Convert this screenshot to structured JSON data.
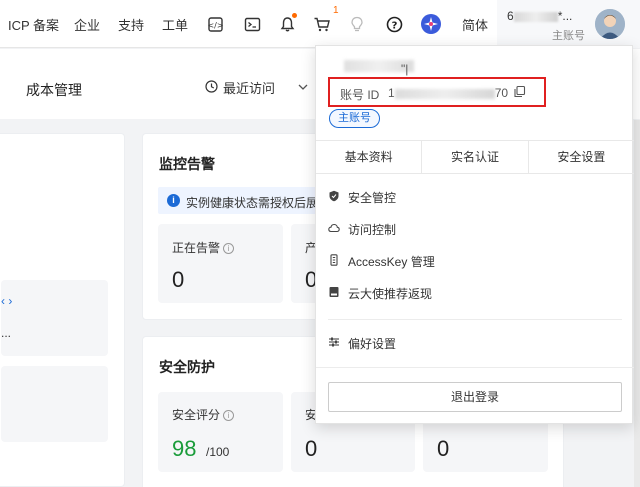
{
  "topbar": {
    "icp": "ICP 备案",
    "enterprise": "企业",
    "support": "支持",
    "ticket": "工单",
    "cart_count": "1",
    "lang": "简体",
    "account_name_visible": "6",
    "account_name_suffix": "*...",
    "account_type": "主账号"
  },
  "subheader": {
    "title": "成本管理",
    "recent": "最近访问"
  },
  "monitor": {
    "title": "监控告警",
    "notice": "实例健康状态需授权后展",
    "alerting_label": "正在告警",
    "alerting_value": "0",
    "second_label": "产",
    "second_value": "0"
  },
  "security": {
    "title": "安全防护",
    "score_label": "安全评分",
    "score_value": "98",
    "score_max": "/100",
    "second_label": "安",
    "second_value": "0",
    "third_value": "0"
  },
  "left_partial": {
    "arrow": "‹ ›",
    "ellipsis": "..."
  },
  "panel": {
    "name_suffix": "\"|",
    "account_id_label": "账号 ID",
    "account_id_prefix": "1",
    "account_id_suffix": "70",
    "badge": "主账号",
    "tabs": [
      "基本资料",
      "实名认证",
      "安全设置"
    ],
    "menu": [
      {
        "label": "安全管控",
        "icon": "shield-icon"
      },
      {
        "label": "访问控制",
        "icon": "cloud-icon"
      },
      {
        "label": "AccessKey 管理",
        "icon": "key-icon"
      },
      {
        "label": "云大使推荐返现",
        "icon": "book-icon"
      }
    ],
    "preferences": "偏好设置",
    "logout": "退出登录"
  },
  "colors": {
    "accent": "#1b6ad6",
    "highlight_border": "#e02020",
    "score_green": "#1a9c3a",
    "notification": "#ff6a00"
  }
}
